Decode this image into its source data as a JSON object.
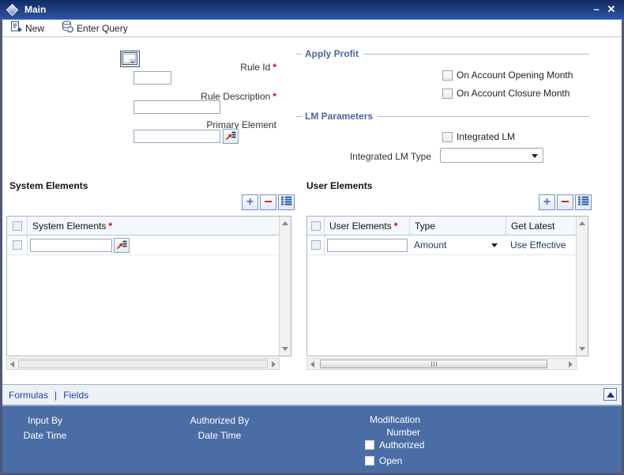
{
  "window": {
    "title": "Main"
  },
  "icons": {
    "minimize": "–",
    "close": "✕",
    "plus": "+",
    "minus": "−"
  },
  "toolbar": {
    "new_label": "New",
    "enter_query_label": "Enter Query"
  },
  "misc": {
    "required_marker": "*",
    "separator": "|"
  },
  "form": {
    "rule_id_label": "Rule Id",
    "rule_id_value": "",
    "rule_description_label": "Rule Description",
    "rule_description_value": "",
    "primary_element_label": "Primary Element",
    "primary_element_value": ""
  },
  "apply_profit": {
    "title": "Apply Profit",
    "options": [
      "On Account Opening Month",
      "On Account Closure Month"
    ]
  },
  "lm_parameters": {
    "title": "LM Parameters",
    "integrated_lm_label": "Integrated LM",
    "integrated_lm_type_label": "Integrated LM Type",
    "integrated_lm_type_value": ""
  },
  "system_elements": {
    "title": "System Elements",
    "column_header": "System Elements",
    "row_value": ""
  },
  "user_elements": {
    "title": "User Elements",
    "col_user_elements": "User Elements",
    "col_type": "Type",
    "col_get_latest": "Get Latest",
    "row_user_elements_value": "",
    "row_type_value": "Amount",
    "row_get_latest_value": "Use Effective"
  },
  "links": {
    "formulas": "Formulas",
    "fields": "Fields"
  },
  "footer": {
    "input_by": "Input By",
    "date_time": "Date Time",
    "authorized_by": "Authorized By",
    "modification_line1": "Modification",
    "modification_line2": "Number",
    "authorized_label": "Authorized",
    "open_label": "Open"
  },
  "colors": {
    "titlebar_top": "#102962",
    "titlebar_bottom": "#2e55a3",
    "footer_bg": "#4a6da6",
    "section_header": "#4a67a0",
    "required_red": "#cc0000",
    "link_blue": "#1f3fae",
    "button_plus_blue": "#4a74c0",
    "button_minus_red": "#c5251f",
    "value_navy": "#1f3d66"
  }
}
